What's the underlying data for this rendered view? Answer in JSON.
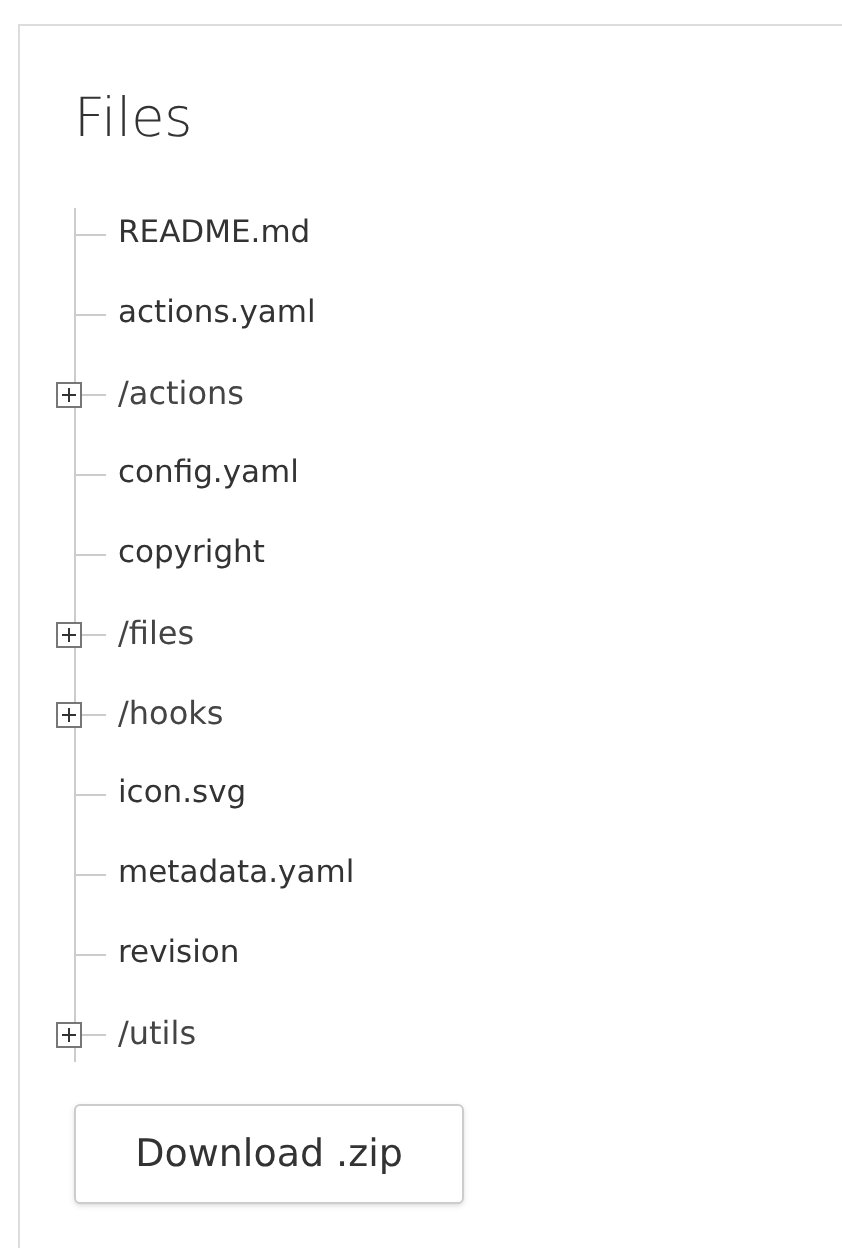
{
  "title": "Files",
  "tree": [
    {
      "kind": "file",
      "label": "README.md"
    },
    {
      "kind": "file",
      "label": "actions.yaml"
    },
    {
      "kind": "folder",
      "label": "/actions",
      "expanded": false
    },
    {
      "kind": "file",
      "label": "config.yaml"
    },
    {
      "kind": "file",
      "label": "copyright"
    },
    {
      "kind": "folder",
      "label": "/files",
      "expanded": false
    },
    {
      "kind": "folder",
      "label": "/hooks",
      "expanded": false
    },
    {
      "kind": "file",
      "label": "icon.svg"
    },
    {
      "kind": "file",
      "label": "metadata.yaml"
    },
    {
      "kind": "file",
      "label": "revision"
    },
    {
      "kind": "folder",
      "label": "/utils",
      "expanded": false
    }
  ],
  "button": "Download .zip"
}
